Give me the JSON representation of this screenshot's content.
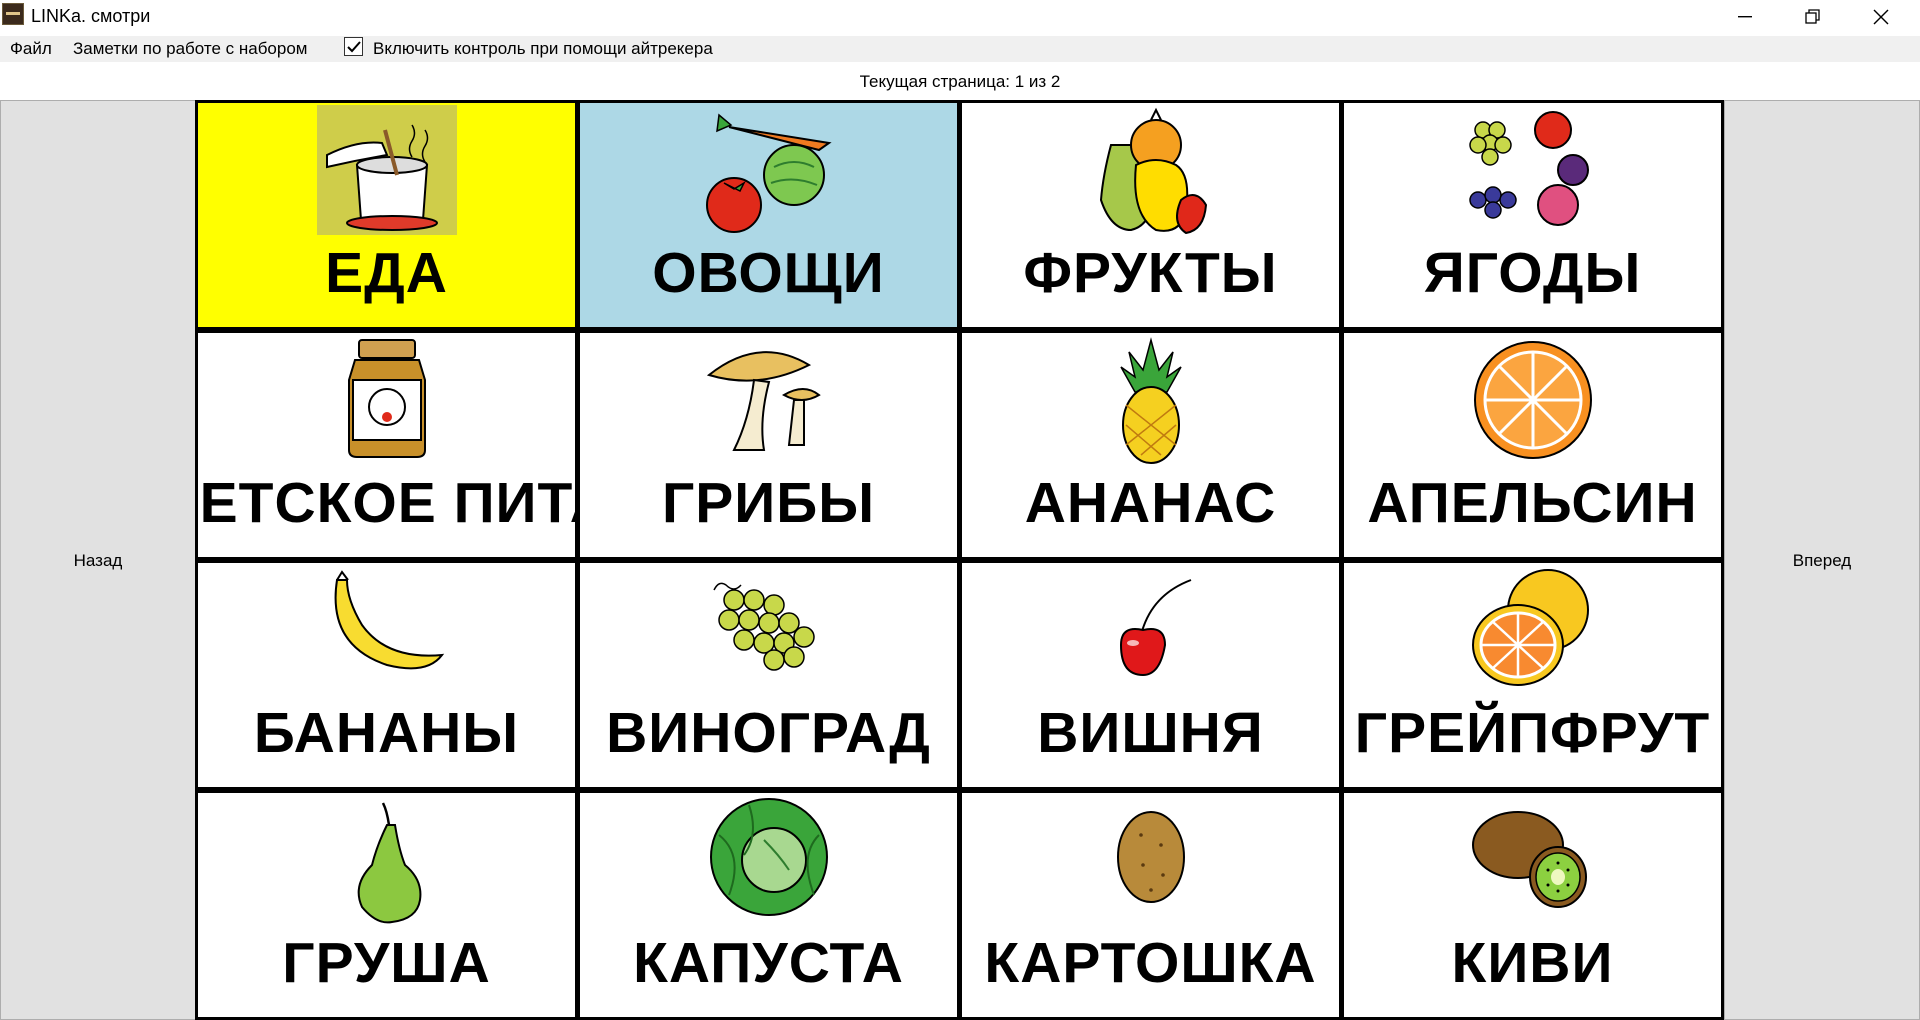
{
  "window": {
    "title": "LINKa. смотри"
  },
  "menu": {
    "file": "Файл",
    "notes": "Заметки по работе с набором",
    "eyetracker_label": "Включить контроль при помощи айтрекера",
    "eyetracker_checked": true
  },
  "page_indicator": "Текущая страница: 1 из 2",
  "nav": {
    "back": "Назад",
    "forward": "Вперед"
  },
  "colors": {
    "selected_tile": "#ffff00",
    "hovered_tile": "#add8e6",
    "tile": "#ffffff"
  },
  "tiles": [
    {
      "label": "ЕДА",
      "icon": "cooking-pot-icon",
      "state": "selected"
    },
    {
      "label": "ОВОЩИ",
      "icon": "vegetables-icon",
      "state": "highlighted"
    },
    {
      "label": "ФРУКТЫ",
      "icon": "fruits-icon"
    },
    {
      "label": "ЯГОДЫ",
      "icon": "berries-icon"
    },
    {
      "label": "ДЕТСКОЕ ПИТАНИЕ",
      "icon": "baby-food-jar-icon"
    },
    {
      "label": "ГРИБЫ",
      "icon": "mushroom-icon"
    },
    {
      "label": "АНАНАС",
      "icon": "pineapple-icon"
    },
    {
      "label": "АПЕЛЬСИН",
      "icon": "orange-icon"
    },
    {
      "label": "БАНАНЫ",
      "icon": "banana-icon"
    },
    {
      "label": "ВИНОГРАД",
      "icon": "grapes-icon"
    },
    {
      "label": "ВИШНЯ",
      "icon": "cherry-icon"
    },
    {
      "label": "ГРЕЙПФРУТ",
      "icon": "grapefruit-icon"
    },
    {
      "label": "ГРУША",
      "icon": "pear-icon"
    },
    {
      "label": "КАПУСТА",
      "icon": "cabbage-icon"
    },
    {
      "label": "КАРТОШКА",
      "icon": "potato-icon"
    },
    {
      "label": "КИВИ",
      "icon": "kiwi-icon"
    }
  ]
}
